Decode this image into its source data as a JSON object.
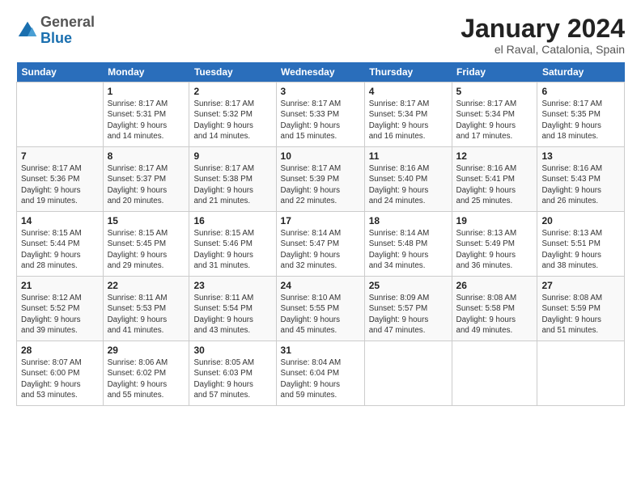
{
  "header": {
    "logo_general": "General",
    "logo_blue": "Blue",
    "month_title": "January 2024",
    "location": "el Raval, Catalonia, Spain"
  },
  "columns": [
    "Sunday",
    "Monday",
    "Tuesday",
    "Wednesday",
    "Thursday",
    "Friday",
    "Saturday"
  ],
  "weeks": [
    [
      {
        "day": "",
        "info": ""
      },
      {
        "day": "1",
        "info": "Sunrise: 8:17 AM\nSunset: 5:31 PM\nDaylight: 9 hours\nand 14 minutes."
      },
      {
        "day": "2",
        "info": "Sunrise: 8:17 AM\nSunset: 5:32 PM\nDaylight: 9 hours\nand 14 minutes."
      },
      {
        "day": "3",
        "info": "Sunrise: 8:17 AM\nSunset: 5:33 PM\nDaylight: 9 hours\nand 15 minutes."
      },
      {
        "day": "4",
        "info": "Sunrise: 8:17 AM\nSunset: 5:34 PM\nDaylight: 9 hours\nand 16 minutes."
      },
      {
        "day": "5",
        "info": "Sunrise: 8:17 AM\nSunset: 5:34 PM\nDaylight: 9 hours\nand 17 minutes."
      },
      {
        "day": "6",
        "info": "Sunrise: 8:17 AM\nSunset: 5:35 PM\nDaylight: 9 hours\nand 18 minutes."
      }
    ],
    [
      {
        "day": "7",
        "info": "Sunrise: 8:17 AM\nSunset: 5:36 PM\nDaylight: 9 hours\nand 19 minutes."
      },
      {
        "day": "8",
        "info": "Sunrise: 8:17 AM\nSunset: 5:37 PM\nDaylight: 9 hours\nand 20 minutes."
      },
      {
        "day": "9",
        "info": "Sunrise: 8:17 AM\nSunset: 5:38 PM\nDaylight: 9 hours\nand 21 minutes."
      },
      {
        "day": "10",
        "info": "Sunrise: 8:17 AM\nSunset: 5:39 PM\nDaylight: 9 hours\nand 22 minutes."
      },
      {
        "day": "11",
        "info": "Sunrise: 8:16 AM\nSunset: 5:40 PM\nDaylight: 9 hours\nand 24 minutes."
      },
      {
        "day": "12",
        "info": "Sunrise: 8:16 AM\nSunset: 5:41 PM\nDaylight: 9 hours\nand 25 minutes."
      },
      {
        "day": "13",
        "info": "Sunrise: 8:16 AM\nSunset: 5:43 PM\nDaylight: 9 hours\nand 26 minutes."
      }
    ],
    [
      {
        "day": "14",
        "info": "Sunrise: 8:15 AM\nSunset: 5:44 PM\nDaylight: 9 hours\nand 28 minutes."
      },
      {
        "day": "15",
        "info": "Sunrise: 8:15 AM\nSunset: 5:45 PM\nDaylight: 9 hours\nand 29 minutes."
      },
      {
        "day": "16",
        "info": "Sunrise: 8:15 AM\nSunset: 5:46 PM\nDaylight: 9 hours\nand 31 minutes."
      },
      {
        "day": "17",
        "info": "Sunrise: 8:14 AM\nSunset: 5:47 PM\nDaylight: 9 hours\nand 32 minutes."
      },
      {
        "day": "18",
        "info": "Sunrise: 8:14 AM\nSunset: 5:48 PM\nDaylight: 9 hours\nand 34 minutes."
      },
      {
        "day": "19",
        "info": "Sunrise: 8:13 AM\nSunset: 5:49 PM\nDaylight: 9 hours\nand 36 minutes."
      },
      {
        "day": "20",
        "info": "Sunrise: 8:13 AM\nSunset: 5:51 PM\nDaylight: 9 hours\nand 38 minutes."
      }
    ],
    [
      {
        "day": "21",
        "info": "Sunrise: 8:12 AM\nSunset: 5:52 PM\nDaylight: 9 hours\nand 39 minutes."
      },
      {
        "day": "22",
        "info": "Sunrise: 8:11 AM\nSunset: 5:53 PM\nDaylight: 9 hours\nand 41 minutes."
      },
      {
        "day": "23",
        "info": "Sunrise: 8:11 AM\nSunset: 5:54 PM\nDaylight: 9 hours\nand 43 minutes."
      },
      {
        "day": "24",
        "info": "Sunrise: 8:10 AM\nSunset: 5:55 PM\nDaylight: 9 hours\nand 45 minutes."
      },
      {
        "day": "25",
        "info": "Sunrise: 8:09 AM\nSunset: 5:57 PM\nDaylight: 9 hours\nand 47 minutes."
      },
      {
        "day": "26",
        "info": "Sunrise: 8:08 AM\nSunset: 5:58 PM\nDaylight: 9 hours\nand 49 minutes."
      },
      {
        "day": "27",
        "info": "Sunrise: 8:08 AM\nSunset: 5:59 PM\nDaylight: 9 hours\nand 51 minutes."
      }
    ],
    [
      {
        "day": "28",
        "info": "Sunrise: 8:07 AM\nSunset: 6:00 PM\nDaylight: 9 hours\nand 53 minutes."
      },
      {
        "day": "29",
        "info": "Sunrise: 8:06 AM\nSunset: 6:02 PM\nDaylight: 9 hours\nand 55 minutes."
      },
      {
        "day": "30",
        "info": "Sunrise: 8:05 AM\nSunset: 6:03 PM\nDaylight: 9 hours\nand 57 minutes."
      },
      {
        "day": "31",
        "info": "Sunrise: 8:04 AM\nSunset: 6:04 PM\nDaylight: 9 hours\nand 59 minutes."
      },
      {
        "day": "",
        "info": ""
      },
      {
        "day": "",
        "info": ""
      },
      {
        "day": "",
        "info": ""
      }
    ]
  ]
}
